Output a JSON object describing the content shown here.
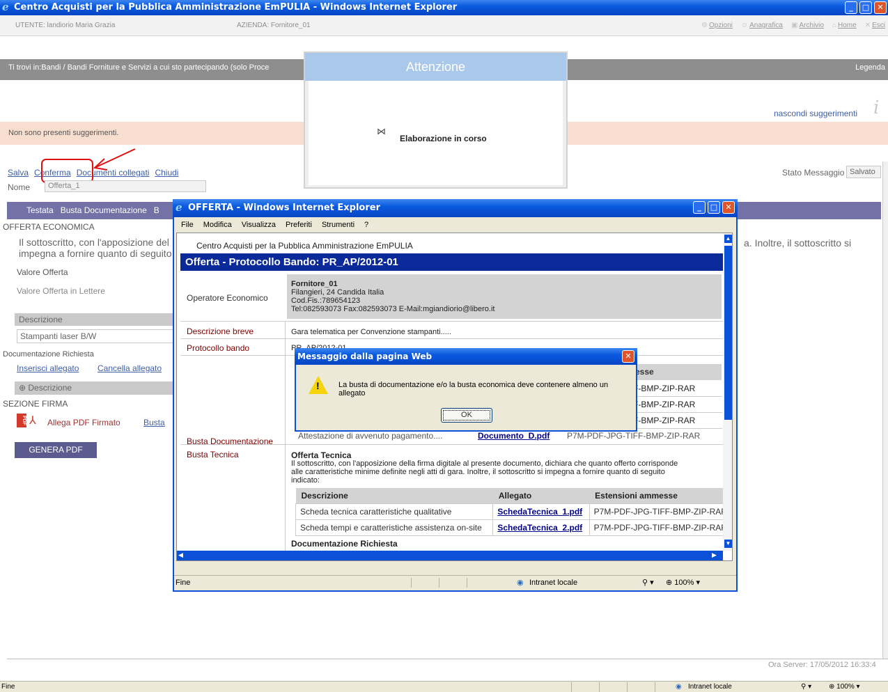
{
  "main_window": {
    "title": "Centro Acquisti per la Pubblica Amministrazione EmPULIA - Windows Internet Explorer",
    "user_label": "UTENTE: landiorio Maria Grazia",
    "company_label": "AZIENDA: Fornitore_01",
    "nav": [
      "Opzioni",
      "Anagrafica",
      "Archivio",
      "Home",
      "Esci"
    ],
    "breadcrumb": "Ti trovi in:Bandi / Bandi Forniture e Servizi a cui sto partecipando (solo Proce",
    "legend": "Legenda",
    "hide_suggestions": "nascondi suggerimenti",
    "no_suggestions": "Non sono presenti suggerimenti.",
    "toolbar": {
      "save": "Salva",
      "confirm": "Conferma",
      "linked_docs": "Documenti collegati",
      "close": "Chiudi"
    },
    "name_label": "Nome",
    "name_value": "Offerta_1",
    "message_status_label": "Stato Messaggio",
    "message_status_value": "Salvato",
    "tabs": [
      "Testata",
      "Busta Documentazione",
      "B"
    ],
    "section_economic": "OFFERTA ECONOMICA",
    "intro_left_1": "Il sottoscritto, con l'apposizione del",
    "intro_left_2": "impegna a fornire quanto di seguito",
    "intro_right": "a. Inoltre, il sottoscritto si",
    "offer_value": "Valore Offerta",
    "offer_value_words": "Valore Offerta in Lettere",
    "description_header": "Descrizione",
    "description_value": "Stampanti laser B/W",
    "required_docs": "Documentazione Richiesta",
    "insert_attachment": "Inserisci allegato",
    "delete_attachment": "Cancella allegato",
    "description_col": "Descrizione",
    "signature_section": "SEZIONE FIRMA",
    "attach_signed_pdf": "Allega PDF Firmato",
    "busta_link": "Busta",
    "generate_pdf": "GENERA PDF",
    "server_time": "Ora Server: 17/05/2012 16:33:4",
    "status_left": "Fine",
    "status_zone": "Intranet locale",
    "status_zoom": "100%"
  },
  "attention_dialog": {
    "title": "Attenzione",
    "message": "Elaborazione in corso"
  },
  "offer_window": {
    "title": "OFFERTA - Windows Internet Explorer",
    "menu": [
      "File",
      "Modifica",
      "Visualizza",
      "Preferiti",
      "Strumenti",
      "?"
    ],
    "site_name": "Centro Acquisti per la Pubblica Amministrazione EmPULIA",
    "header": "Offerta - Protocollo Bando: PR_AP/2012-01",
    "operator_label": "Operatore Economico",
    "operator_name": "Fornitore_01",
    "operator_address": "Filangieri, 24 Candida Italia",
    "operator_fiscal": "Cod.Fis.:789654123",
    "operator_contact": "Tel:082593073 Fax:082593073 E-Mail:mgiandiorio@libero.it",
    "short_desc_label": "Descrizione breve",
    "short_desc_value": "Gara telematica per Convenzione stampanti.....",
    "protocol_label": "Protocollo bando",
    "protocol_value": "PR_AP/2012-01",
    "doc_envelope_label": "Busta Documentazione",
    "doc_table_partial_header": "esse",
    "doc_rows": [
      {
        "ext": "F-BMP-ZIP-RAR"
      },
      {
        "ext": "F-BMP-ZIP-RAR"
      },
      {
        "ext": "F-BMP-ZIP-RAR"
      },
      {
        "desc": "Attestazione di avvenuto pagamento....",
        "file": "Documento_D.pdf",
        "ext": "P7M-PDF-JPG-TIFF-BMP-ZIP-RAR"
      }
    ],
    "tech_envelope_label": "Busta Tecnica",
    "tech_title": "Offerta Tecnica",
    "tech_text_1": "Il sottoscritto, con l'apposizione della firma digitale al presente documento, dichiara che quanto offerto corrisponde",
    "tech_text_2": "alle caratteristiche minime definite negli atti di gara. Inoltre, il sottoscritto si impegna a fornire quanto di seguito",
    "tech_text_3": "indicato:",
    "tech_headers": [
      "Descrizione",
      "Allegato",
      "Estensioni ammesse"
    ],
    "tech_rows": [
      {
        "desc": "Scheda tecnica caratteristiche qualitative",
        "file": "SchedaTecnica_1.pdf",
        "ext": "P7M-PDF-JPG-TIFF-BMP-ZIP-RAR"
      },
      {
        "desc": "Scheda tempi e caratteristiche assistenza on-site",
        "file": "SchedaTecnica_2.pdf",
        "ext": "P7M-PDF-JPG-TIFF-BMP-ZIP-RAR"
      }
    ],
    "required_docs": "Documentazione Richiesta",
    "status_left": "Fine",
    "status_zone": "Intranet locale",
    "status_zoom": "100%"
  },
  "message_box": {
    "title": "Messaggio dalla pagina Web",
    "text": "La busta di documentazione e/o la busta economica deve contenere almeno un allegato",
    "ok": "OK"
  },
  "colors": {
    "accent": "#0a5adf",
    "tab_bar": "#7371a6",
    "label_red": "#800000",
    "annotation_red": "#e01010"
  }
}
